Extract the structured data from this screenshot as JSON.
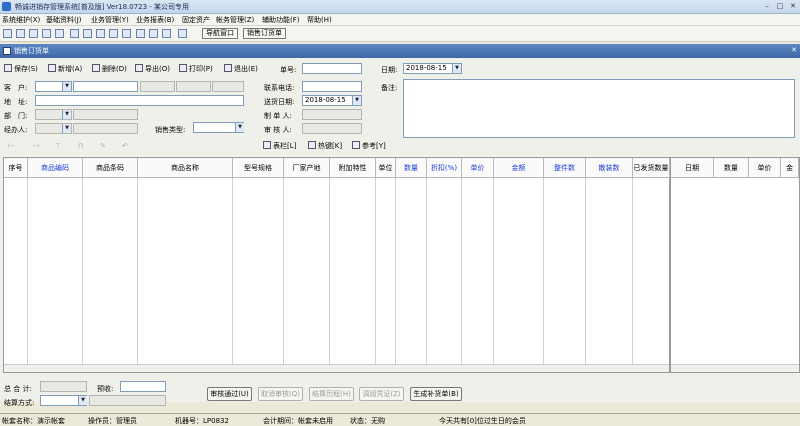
{
  "window": {
    "title": "畅诚进销存管理系统[普及版] Ver18.0723 - 某公司专用",
    "min": "–",
    "max": "□",
    "close": "✕"
  },
  "menu": [
    "系统维护(X)",
    "基础资料(J)",
    "业务管理(Y)",
    "业务报表(B)",
    "固定资产",
    "帐务管理(Z)",
    "辅助功能(F)",
    "帮助(H)"
  ],
  "toolbar": {
    "nav_button": "导航窗口",
    "order_button": "销售订货单"
  },
  "child_window": {
    "title": "销售订货单",
    "close": "✕"
  },
  "actions": {
    "save": "保存(S)",
    "add": "新增(A)",
    "delete": "删除(D)",
    "export": "导出(O)",
    "print": "打印(P)",
    "exit": "退出(E)"
  },
  "form": {
    "order_no_label": "单号:",
    "order_no": "",
    "date_label": "日期:",
    "date": "2018-08-15",
    "customer_label": "客　户:",
    "customer": "",
    "address_label": "地　址:",
    "address": "",
    "department_label": "部　门:",
    "department": "",
    "handler_label": "经办人:",
    "handler": "",
    "sales_type_label": "销售类型:",
    "sales_type": "",
    "phone_label": "联系电话:",
    "phone": "",
    "delivery_date_label": "送货日期:",
    "delivery_date": "2018-08-15",
    "creator_label": "制 单 人:",
    "creator": "",
    "auditor_label": "审 核 人:",
    "auditor": "",
    "remark_label": "备注:",
    "remark": ""
  },
  "grid_tools": {
    "columns": "表栏[L]",
    "hotkeys": "热键[K]",
    "reference": "参考[Y]"
  },
  "table": {
    "columns": [
      {
        "label": "序号",
        "blue": false
      },
      {
        "label": "商品编码",
        "blue": true
      },
      {
        "label": "商品条码",
        "blue": false
      },
      {
        "label": "商品名称",
        "blue": false
      },
      {
        "label": "型号规格",
        "blue": false
      },
      {
        "label": "厂家产地",
        "blue": false
      },
      {
        "label": "附加特性",
        "blue": false
      },
      {
        "label": "单位",
        "blue": false
      },
      {
        "label": "数量",
        "blue": true
      },
      {
        "label": "折扣(%)",
        "blue": true
      },
      {
        "label": "单价",
        "blue": true
      },
      {
        "label": "金额",
        "blue": true
      },
      {
        "label": "整件数",
        "blue": true
      },
      {
        "label": "散装数",
        "blue": true
      },
      {
        "label": "已发货数量",
        "blue": false
      }
    ],
    "right_columns": [
      "日期",
      "数量",
      "单价",
      "金"
    ]
  },
  "footer": {
    "total_label": "总 合 计:",
    "total": "",
    "prepaid_label": "预收:",
    "prepaid": "",
    "settle_label": "结算方式:",
    "settle": "",
    "approve": "审核通过(U)",
    "cancel_approve": "取消审核(Q)",
    "settle_history": "结算历程(H)",
    "voucher": "调阅凭证(Z)",
    "make_supplement": "生成补货单(B)"
  },
  "status": {
    "account": "帐套名称：演示帐套",
    "operator": "操作员：管理员",
    "machine": "机器号：LP0832",
    "period": "会计期间：帐套未启用",
    "state": "状态：无购",
    "birthday": "今天共有[0]位过生日的会员"
  }
}
